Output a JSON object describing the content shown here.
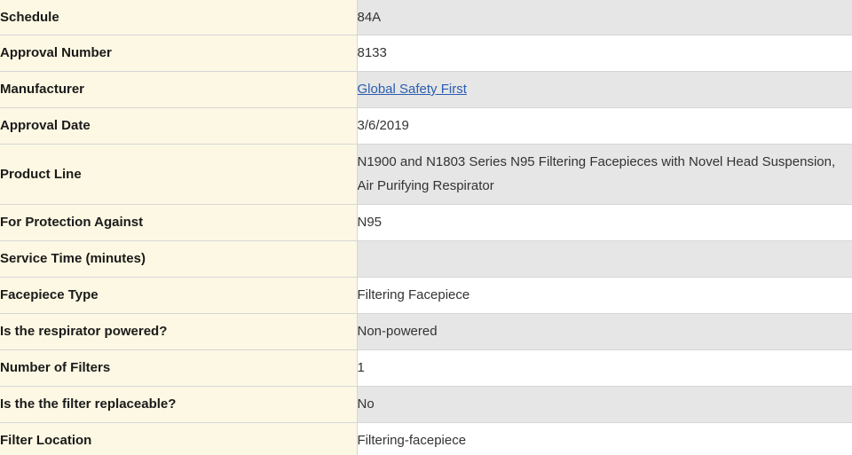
{
  "rows": [
    {
      "label": "Schedule",
      "value": "84A"
    },
    {
      "label": "Approval Number",
      "value": "8133"
    },
    {
      "label": "Manufacturer",
      "value": "Global Safety First",
      "link": true
    },
    {
      "label": "Approval Date",
      "value": "3/6/2019"
    },
    {
      "label": "Product Line",
      "value": "N1900 and N1803 Series N95 Filtering Facepieces with Novel Head Suspension, Air Purifying Respirator"
    },
    {
      "label": "For Protection Against",
      "value": "N95"
    },
    {
      "label": "Service Time (minutes)",
      "value": ""
    },
    {
      "label": "Facepiece Type",
      "value": "Filtering Facepiece"
    },
    {
      "label": "Is the respirator powered?",
      "value": "Non-powered"
    },
    {
      "label": "Number of Filters",
      "value": "1"
    },
    {
      "label": "Is the the filter replaceable?",
      "value": "No"
    },
    {
      "label": "Filter Location",
      "value": "Filtering-facepiece"
    }
  ]
}
